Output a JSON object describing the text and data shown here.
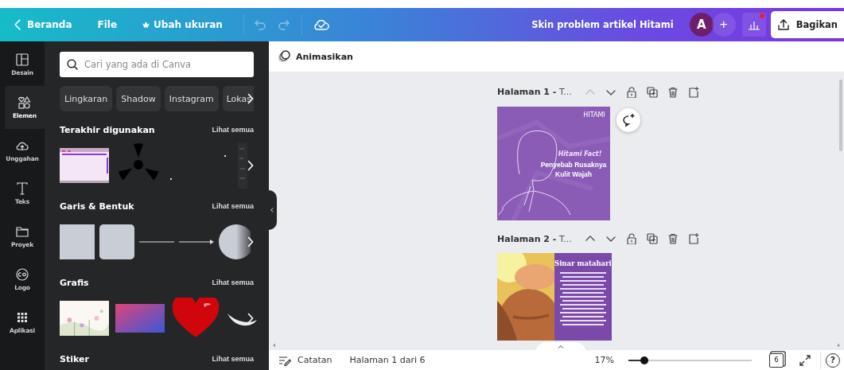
{
  "topbar": {
    "back": "Beranda",
    "menu": [
      "File"
    ],
    "resize": "Ubah ukuran",
    "undo": {
      "disabled": true
    },
    "redo": {
      "disabled": true
    },
    "title": "Skin problem artikel Hitami",
    "avatar": "A",
    "add": "+",
    "insights": {
      "notification": true
    },
    "share": "Bagikan"
  },
  "rail": [
    {
      "label": "Desain",
      "selected": false
    },
    {
      "label": "Elemen",
      "selected": true
    },
    {
      "label": "Unggahan",
      "selected": false
    },
    {
      "label": "Teks",
      "selected": false
    },
    {
      "label": "Proyek",
      "selected": false
    },
    {
      "label": "Logo",
      "selected": false
    },
    {
      "label": "Aplikasi",
      "selected": false
    }
  ],
  "panel": {
    "search": {
      "placeholder": "Cari yang ada di Canva"
    },
    "chips": [
      "Lingkaran",
      "Shadow",
      "Instagram",
      "Lokas"
    ],
    "sections": [
      {
        "title": "Terakhir digunakan",
        "see_all": "Lihat semua",
        "items": [
          {
            "kind": "picture"
          },
          {
            "kind": "radiation"
          },
          {
            "kind": "dots"
          },
          {
            "kind": "strip"
          }
        ]
      },
      {
        "title": "Garis & Bentuk",
        "see_all": "Lihat semua",
        "items": [
          {
            "kind": "square"
          },
          {
            "kind": "rounded"
          },
          {
            "kind": "line"
          },
          {
            "kind": "arrow"
          },
          {
            "kind": "halfcircle"
          }
        ]
      },
      {
        "title": "Grafis",
        "see_all": "Lihat semua",
        "items": [
          {
            "kind": "picture"
          },
          {
            "kind": "gradient"
          },
          {
            "kind": "heart"
          },
          {
            "kind": "swoosh"
          }
        ]
      },
      {
        "title": "Stiker",
        "see_all": "Lihat semua"
      }
    ]
  },
  "toolbar": {
    "animate": "Animasikan"
  },
  "pages": [
    {
      "title": "**Halaman 1 -** T...",
      "up_disabled": true,
      "design": {
        "kind": "lineart",
        "logo": "HITAMI",
        "kicker": "Hitami Fact!",
        "headline": "Penyebab Rusaknya Kulit Wajah"
      }
    },
    {
      "title": "**Halaman 2 -** T...",
      "up_disabled": false,
      "design": {
        "headline": "Sinar matahari"
      }
    }
  ],
  "bottom": {
    "notes": "Catatan",
    "page_info": "Halaman 1 dari 6",
    "zoom": "17%",
    "zoom_slider": {
      "level": 0.13
    },
    "page_count": "6",
    "help": "?"
  }
}
